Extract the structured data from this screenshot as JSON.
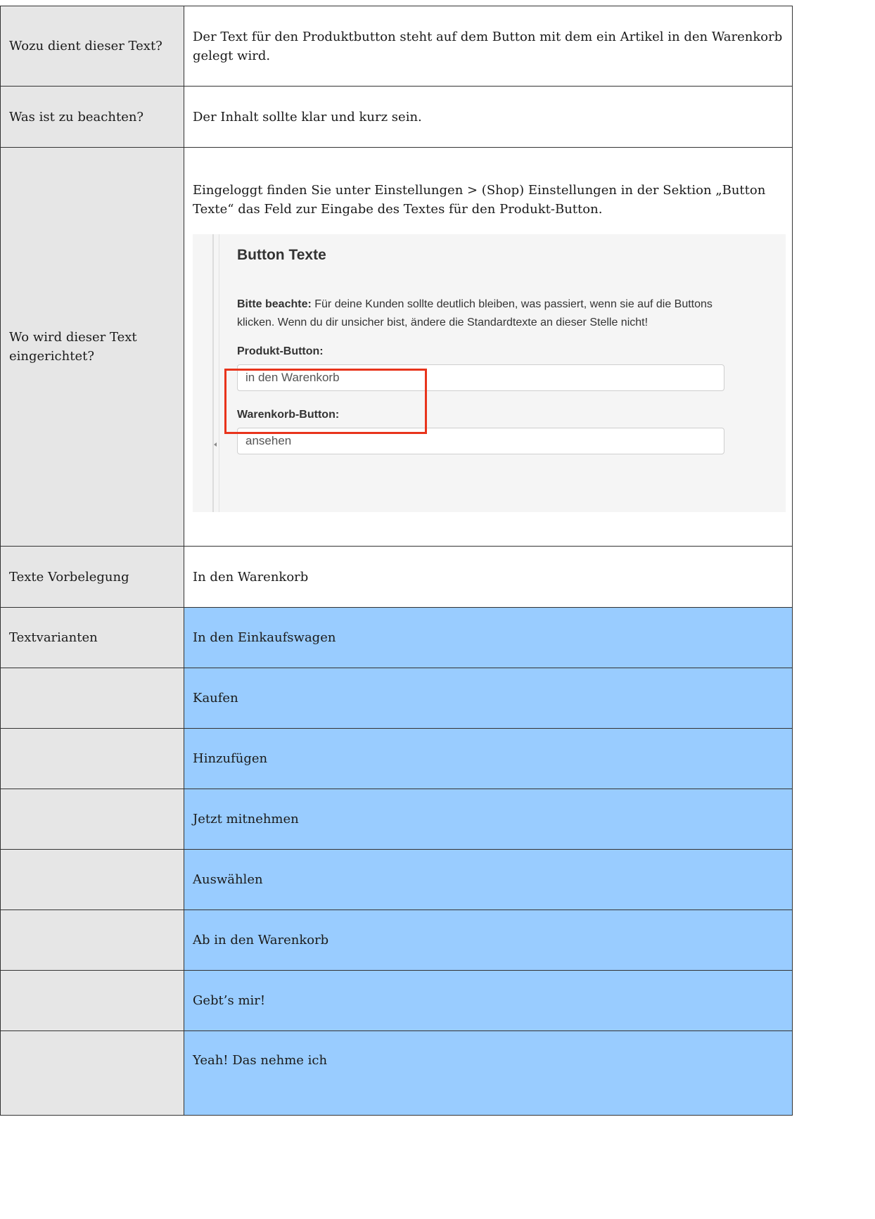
{
  "rows": {
    "purpose": {
      "label": "Wozu dient dieser Text?",
      "value": "Der Text für den Produktbutton steht auf dem Button mit dem ein Artikel in den Warenkorb gelegt wird."
    },
    "notes": {
      "label": "Was ist zu beachten?",
      "value": "Der Inhalt sollte klar und kurz sein."
    },
    "location": {
      "label": "Wo wird dieser Text eingerichtet?",
      "intro": "Eingeloggt finden Sie unter Einstellungen > (Shop) Einstellungen in der Sektion „Button Texte“ das Feld zur Eingabe des Textes für den Produkt-Button.",
      "screenshot": {
        "heading": "Button Texte",
        "note_bold": "Bitte beachte:",
        "note_text": " Für deine Kunden sollte deutlich bleiben, was passiert, wenn sie auf die Buttons klicken. Wenn du dir unsicher bist, ändere die Standardtexte an dieser Stelle nicht!",
        "product_button_label": "Produkt-Button:",
        "product_button_value": "in den Warenkorb",
        "cart_button_label": "Warenkorb-Button:",
        "cart_button_value": "ansehen",
        "highlight_color": "#e8341c"
      }
    },
    "default": {
      "label": "Texte Vorbelegung",
      "value": "In den Warenkorb"
    },
    "variants": {
      "label": "Textvarianten",
      "values": [
        "In den Einkaufswagen",
        "Kaufen",
        "Hinzufügen",
        "Jetzt mitnehmen",
        "Auswählen",
        "Ab in den Warenkorb",
        "Gebt’s mir!",
        "Yeah! Das nehme ich"
      ]
    }
  },
  "colors": {
    "label_bg": "#e6e6e6",
    "variant_bg": "#99ccff",
    "border": "#333333"
  }
}
